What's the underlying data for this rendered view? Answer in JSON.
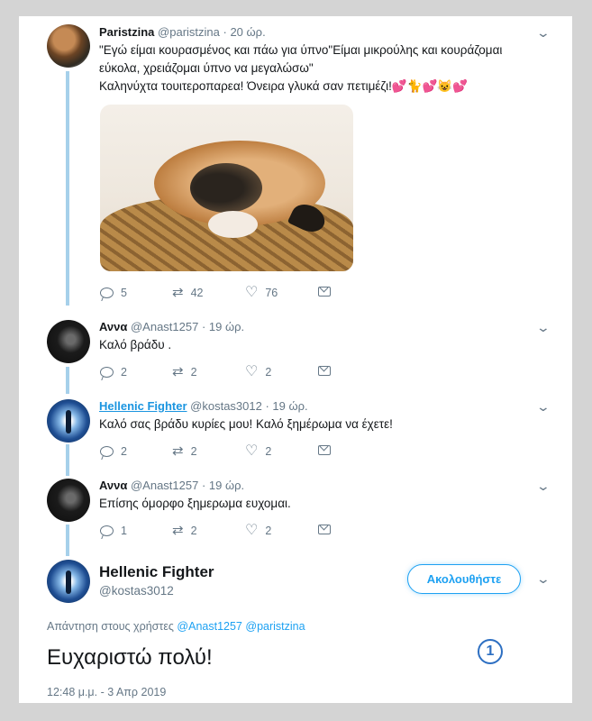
{
  "tweets": [
    {
      "name": "Paristzina",
      "handle": "@paristzina",
      "time": "· 20 ώρ.",
      "text_lines": [
        "\"Εγώ είμαι κουρασμένος και πάω για ύπνο\"Είμαι μικρούλης και κουράζομαι",
        "εύκολα, χρειάζομαι ύπνο να μεγαλώσω\"",
        "Καληνύχτα τουιτεροπαρεα! Όνειρα γλυκά σαν πετιμέζι!💕🐈💕😺💕"
      ],
      "image": "sleeping-puppy-in-basket",
      "replies": "5",
      "retweets": "42",
      "likes": "76"
    },
    {
      "name": "Αννα",
      "handle": "@Anast1257",
      "time": "· 19 ώρ.",
      "text_lines": [
        "Καλό βράδυ ."
      ],
      "replies": "2",
      "retweets": "2",
      "likes": "2"
    },
    {
      "name": "Hellenic Fighter",
      "handle": "@kostas3012",
      "time": "· 19 ώρ.",
      "text_lines": [
        "Καλό σας βράδυ κυρίες μου! Καλό ξημέρωμα να έχετε!"
      ],
      "replies": "2",
      "retweets": "2",
      "likes": "2"
    },
    {
      "name": "Αννα",
      "handle": "@Anast1257",
      "time": "· 19 ώρ.",
      "text_lines": [
        "Επίσης όμορφο ξημερωμα ευχομαι."
      ],
      "replies": "1",
      "retweets": "2",
      "likes": "2"
    }
  ],
  "main_tweet": {
    "name": "Hellenic Fighter",
    "handle": "@kostas3012",
    "follow_label": "Ακολουθήστε",
    "reply_prefix": "Απάντηση στους χρήστες",
    "mention_1": "@Anast1257",
    "mention_2": "@paristzina",
    "text": "Ευχαριστώ πολύ!",
    "timestamp": "12:48 μ.μ. - 3 Απρ 2019"
  },
  "badge": "1",
  "icons": {
    "reply": "reply-icon",
    "retweet": "retweet-icon",
    "like": "heart-icon",
    "dm": "envelope-icon",
    "more": "chevron-down-icon"
  },
  "colors": {
    "accent": "#1da1f2",
    "thread_line": "#a6d0ea",
    "muted": "#657786"
  }
}
